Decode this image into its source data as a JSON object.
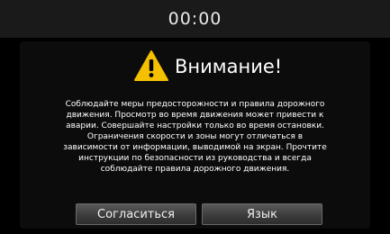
{
  "status_bar": {
    "clock": "00:00"
  },
  "dialog": {
    "icon": "warning-triangle-icon",
    "title": "Внимание!",
    "message": "Соблюдайте меры предосторожности и правила дорожного\nдвижения. Просмотр во время движения может привести к\nаварии. Совершайте настройки только во время остановки.\nОграничения скорости и зоны могут отличаться в\nзависимости от информации, выводимой на экран. Прочтите\nинструкции по безопасности из руководства и всегда\nсоблюдайте правила дорожного движения.",
    "buttons": {
      "agree": "Согласиться",
      "language": "Язык"
    }
  },
  "colors": {
    "background": "#000000",
    "warning_yellow": "#f5c000",
    "text": "#ffffff",
    "button_top": "#5a5a5a",
    "button_bottom": "#2e2e2e"
  }
}
